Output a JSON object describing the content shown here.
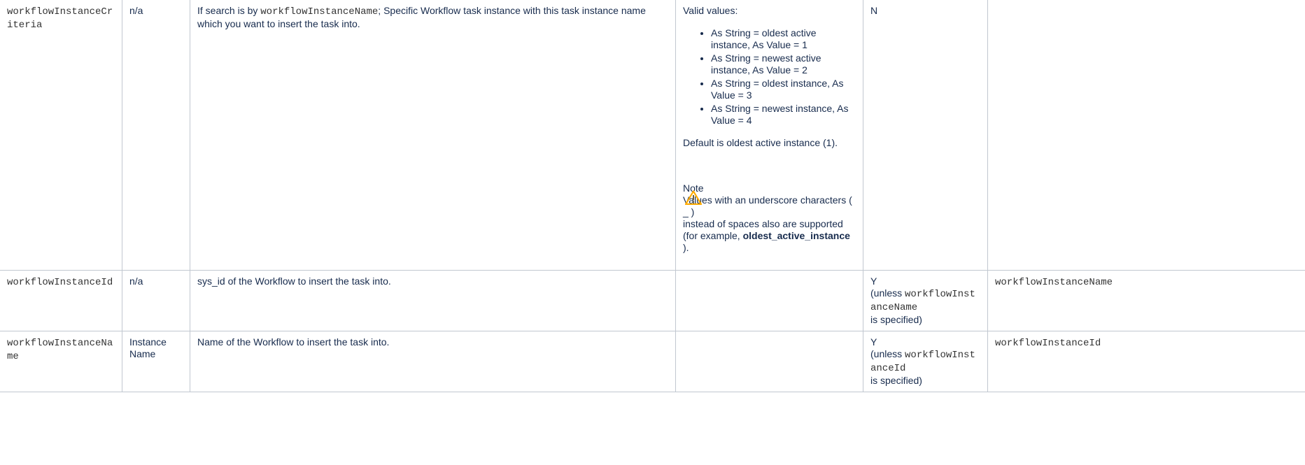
{
  "rows": [
    {
      "field": "workflowInstanceCriteria",
      "label": "n/a",
      "description_prefix": "If search is by ",
      "description_code": "workflowInstanceName",
      "description_suffix": "; Specific Workflow task instance with this task instance name which you want to insert the task into.",
      "valid_values_title": "Valid values:",
      "valid_values": [
        "As String = oldest active instance, As Value = 1",
        "As String = newest active instance, As Value = 2",
        "As String = oldest instance, As Value = 3",
        "As String = newest instance, As Value = 4"
      ],
      "default_text": "Default is oldest active instance (1).",
      "note_title": "Note",
      "note_icon": "warning-icon",
      "note_line1": "Values with an underscore characters ( _ )",
      "note_line2": "instead of spaces also are supported (for example, ",
      "note_bold": "oldest_active_instance",
      "note_line3": ").",
      "required": "N",
      "mutually_exclusive": ""
    },
    {
      "field": "workflowInstanceId",
      "label": "n/a",
      "description": "sys_id of the Workflow to insert the task into.",
      "valid_values_text": "",
      "required_flag": "Y",
      "required_unless": "(unless ",
      "required_code": "workflowInstanceName",
      "required_tail": "is specified)",
      "mutually_exclusive": "workflowInstanceName"
    },
    {
      "field": "workflowInstanceName",
      "label": "Instance Name",
      "description": "Name of the Workflow to insert the task into.",
      "valid_values_text": "",
      "required_flag": "Y",
      "required_unless": "(unless ",
      "required_code": "workflowInstanceId",
      "required_tail": "is specified)",
      "mutually_exclusive": "workflowInstanceId"
    }
  ],
  "colors": {
    "text": "#172b4d",
    "border": "#c1c7d0",
    "warning": "#ffab00"
  }
}
